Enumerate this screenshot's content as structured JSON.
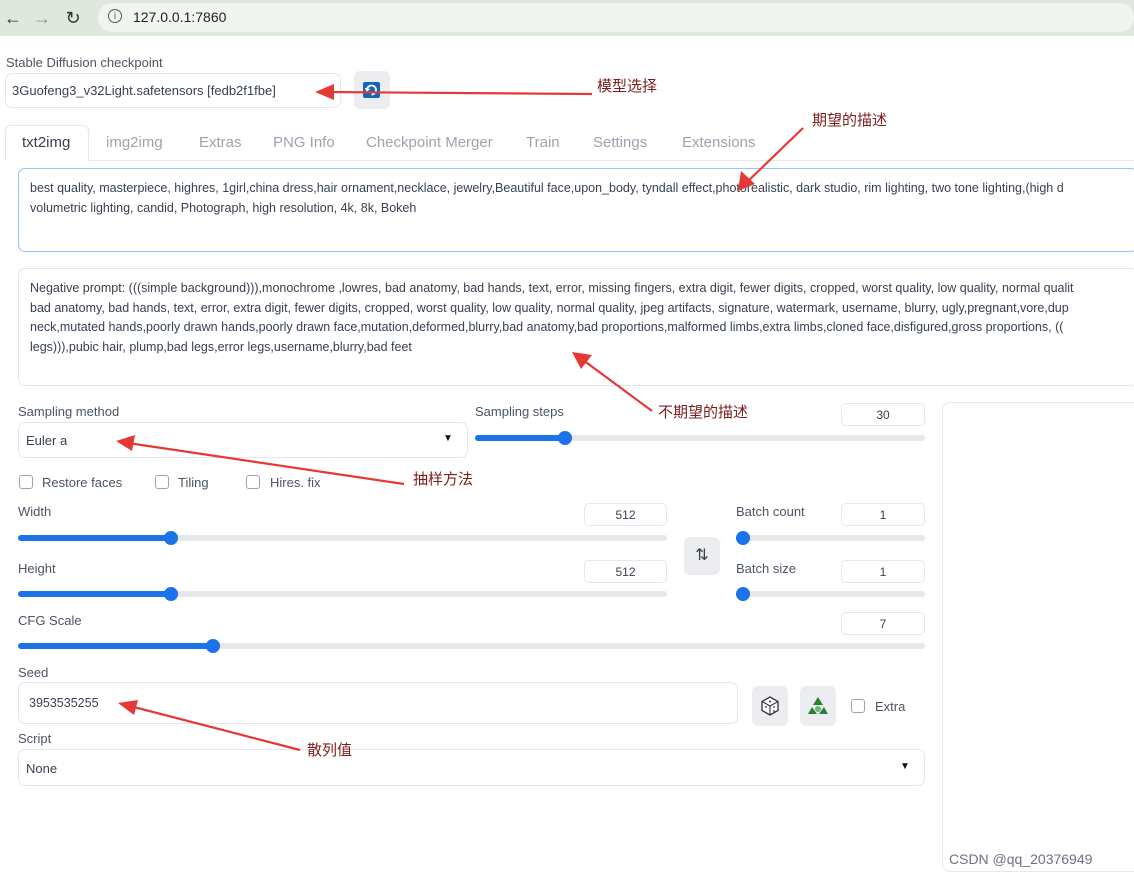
{
  "browser": {
    "url": "127.0.0.1:7860"
  },
  "checkpoint": {
    "label": "Stable Diffusion checkpoint",
    "value": "3Guofeng3_v32Light.safetensors [fedb2f1fbe]"
  },
  "tabs": [
    "txt2img",
    "img2img",
    "Extras",
    "PNG Info",
    "Checkpoint Merger",
    "Train",
    "Settings",
    "Extensions"
  ],
  "prompt": {
    "line1": "best quality, masterpiece, highres, 1girl,china dress,hair ornament,necklace, jewelry,Beautiful face,upon_body, tyndall effect,photorealistic, dark studio, rim lighting, two tone lighting,(high d",
    "line2": "volumetric lighting, candid, Photograph, high resolution, 4k, 8k, Bokeh"
  },
  "negative_prompt": {
    "line1": "Negative prompt: (((simple background))),monochrome ,lowres, bad anatomy, bad hands, text, error, missing fingers, extra digit, fewer digits, cropped, worst quality, low quality, normal qualit",
    "line2": "bad anatomy, bad hands, text, error, extra digit, fewer digits, cropped, worst quality, low quality, normal quality, jpeg artifacts, signature, watermark, username, blurry, ugly,pregnant,vore,dup",
    "line3": "neck,mutated hands,poorly drawn hands,poorly drawn face,mutation,deformed,blurry,bad anatomy,bad proportions,malformed limbs,extra limbs,cloned face,disfigured,gross proportions, ((",
    "line4": "legs))),pubic hair, plump,bad legs,error legs,username,blurry,bad feet"
  },
  "sampling_method": {
    "label": "Sampling method",
    "value": "Euler a"
  },
  "sampling_steps": {
    "label": "Sampling steps",
    "value": "30",
    "fraction": 0.19
  },
  "checkboxes": {
    "restore_faces": "Restore faces",
    "tiling": "Tiling",
    "hires_fix": "Hires. fix"
  },
  "width": {
    "label": "Width",
    "value": "512",
    "fraction": 0.23
  },
  "height": {
    "label": "Height",
    "value": "512",
    "fraction": 0.23
  },
  "batch_count": {
    "label": "Batch count",
    "value": "1",
    "fraction": 0.0
  },
  "batch_size": {
    "label": "Batch size",
    "value": "1",
    "fraction": 0.0
  },
  "cfg_scale": {
    "label": "CFG Scale",
    "value": "7",
    "fraction": 0.21
  },
  "seed": {
    "label": "Seed",
    "value": "3953535255",
    "extra_label": "Extra"
  },
  "script": {
    "label": "Script",
    "value": "None"
  },
  "annotations": {
    "model_select": "模型选择",
    "desired": "期望的描述",
    "undesired": "不期望的描述",
    "sampling": "抽样方法",
    "hash": "散列值"
  },
  "watermark": "CSDN @qq_20376949",
  "colors": {
    "accent": "#1a73e8",
    "annotation_arrow": "#e53935",
    "annotation_text": "#7f1d1d"
  }
}
